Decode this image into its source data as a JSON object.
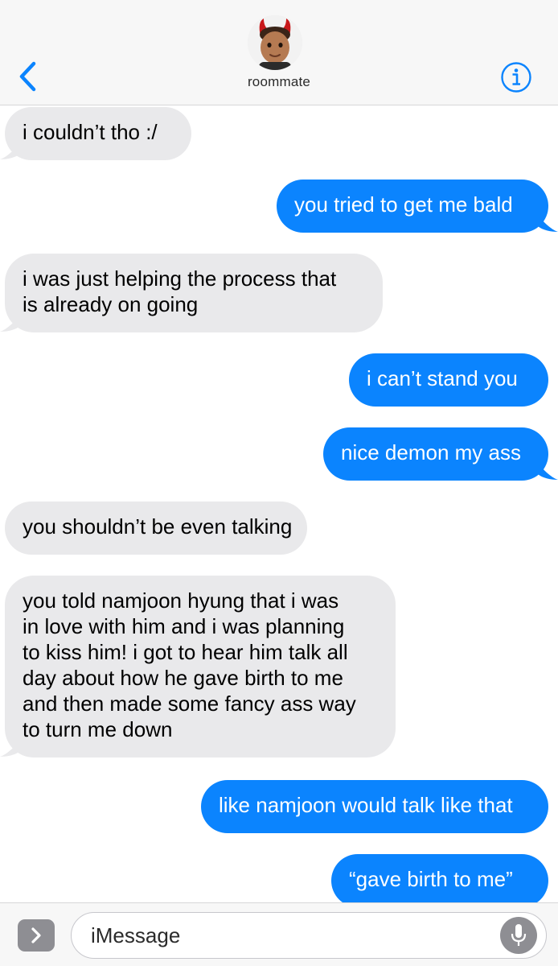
{
  "header": {
    "contact_name": "roommate",
    "avatar_icon": "devil-horns-avatar",
    "back_icon": "chevron-left-icon",
    "info_icon": "info-icon",
    "accent_color": "#0b84fe"
  },
  "messages": [
    {
      "direction": "incoming",
      "lines": [
        "i couldn’t tho :/"
      ]
    },
    {
      "direction": "outgoing",
      "lines": [
        "you tried to get me bald"
      ]
    },
    {
      "direction": "incoming",
      "lines": [
        "i was just helping the process that",
        "is already on going"
      ]
    },
    {
      "direction": "outgoing",
      "lines": [
        "i can’t stand you"
      ]
    },
    {
      "direction": "outgoing",
      "lines": [
        "nice demon my ass"
      ]
    },
    {
      "direction": "incoming",
      "lines": [
        "you shouldn’t be even talking"
      ]
    },
    {
      "direction": "incoming",
      "lines": [
        "you told namjoon hyung that i was",
        "in love with him and i was planning",
        "to kiss him! i got to hear him talk all",
        "day about how he gave birth to me",
        "and then made some fancy ass way",
        "to turn me down"
      ]
    },
    {
      "direction": "outgoing",
      "lines": [
        "like namjoon would talk like that"
      ]
    },
    {
      "direction": "outgoing",
      "lines": [
        "“gave birth to me”"
      ]
    }
  ],
  "composer": {
    "placeholder": "iMessage",
    "apps_icon": "chevron-right-icon",
    "mic_icon": "microphone-icon"
  },
  "colors": {
    "incoming_bubble": "#e9e9eb",
    "outgoing_bubble": "#0b84fe"
  }
}
